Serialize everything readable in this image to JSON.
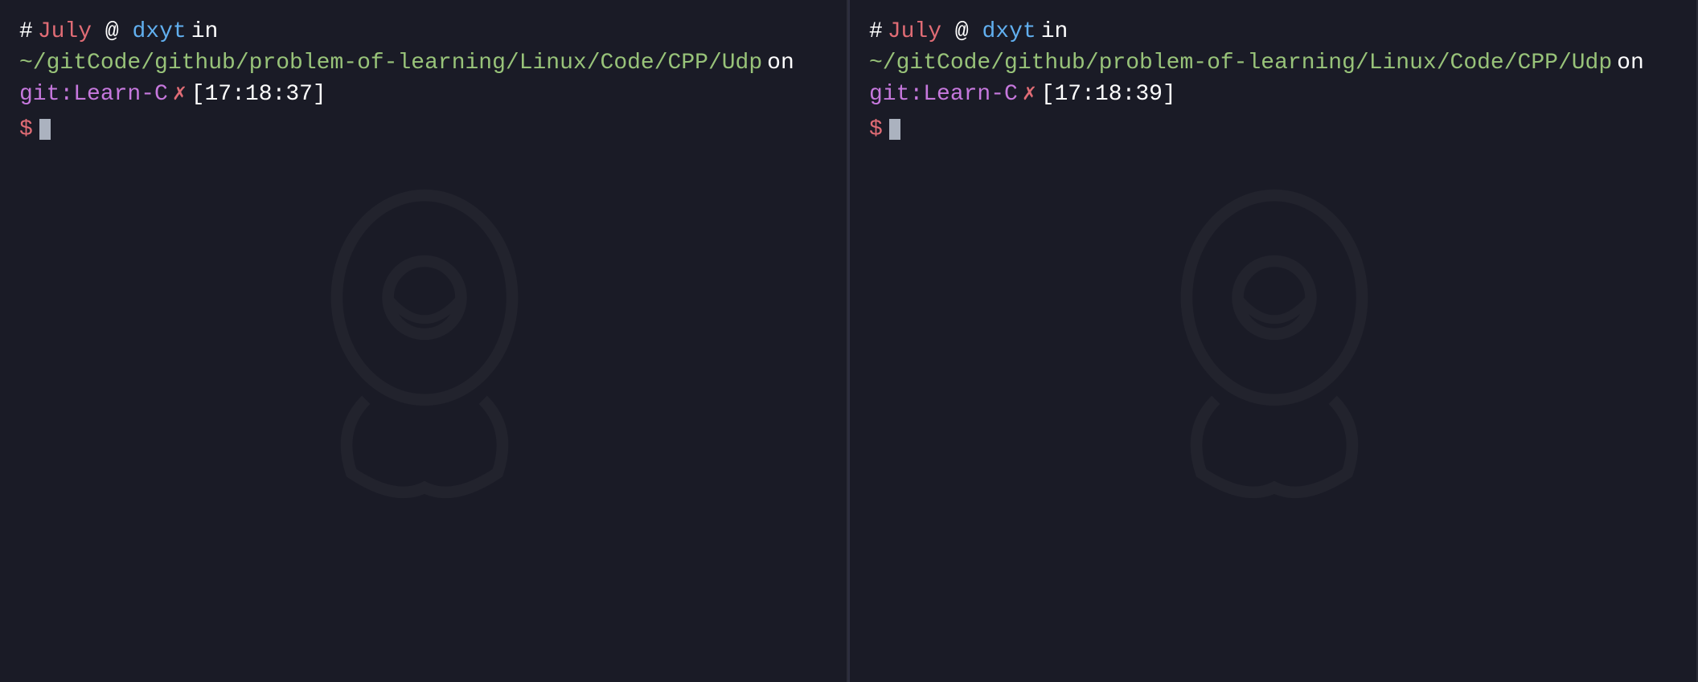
{
  "terminal": {
    "background": "#1a1b26",
    "panes": [
      {
        "id": "left",
        "prompt": {
          "hash": "#",
          "username": "July",
          "at": "@",
          "hostname": "dxyt",
          "in": "in",
          "path": "~/gitCode/github/problem-of-learning/Linux/Code/CPP/Udp",
          "on": "on",
          "git_label": "git:",
          "branch": "Learn-C",
          "x": "✗",
          "time": "[17:18:37]"
        },
        "dollar": "$",
        "cursor": true
      },
      {
        "id": "right",
        "prompt": {
          "hash": "#",
          "username": "July",
          "at": "@",
          "hostname": "dxyt",
          "in": "in",
          "path": "~/gitCode/github/problem-of-learning/Linux/Code/CPP/Udp",
          "on": "on",
          "git_label": "git:",
          "branch": "Learn-C",
          "x": "✗",
          "time": "[17:18:39]"
        },
        "dollar": "$",
        "cursor": true
      }
    ]
  }
}
